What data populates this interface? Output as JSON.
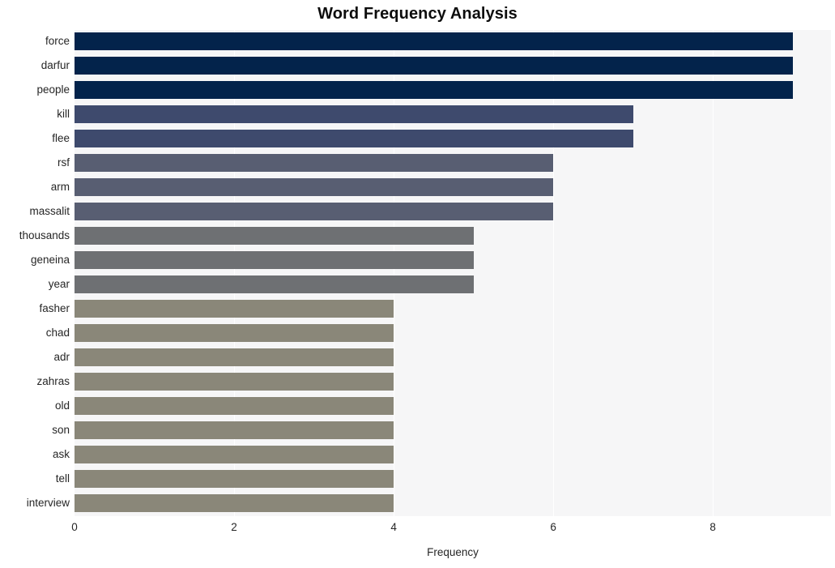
{
  "chart_data": {
    "type": "bar",
    "orientation": "horizontal",
    "title": "Word Frequency Analysis",
    "xlabel": "Frequency",
    "ylabel": "",
    "categories": [
      "force",
      "darfur",
      "people",
      "kill",
      "flee",
      "rsf",
      "arm",
      "massalit",
      "thousands",
      "geneina",
      "year",
      "fasher",
      "chad",
      "adr",
      "zahras",
      "old",
      "son",
      "ask",
      "tell",
      "interview"
    ],
    "values": [
      9,
      9,
      9,
      7,
      7,
      6,
      6,
      6,
      5,
      5,
      5,
      4,
      4,
      4,
      4,
      4,
      4,
      4,
      4,
      4
    ],
    "bar_colors": [
      "#03234b",
      "#03234b",
      "#03234b",
      "#3e4a6d",
      "#3e4a6d",
      "#585e72",
      "#585e72",
      "#585e72",
      "#6e7073",
      "#6e7073",
      "#6e7073",
      "#8a8779",
      "#8a8779",
      "#8a8779",
      "#8a8779",
      "#8a8779",
      "#8a8779",
      "#8a8779",
      "#8a8779",
      "#8a8779"
    ],
    "xlim": [
      0,
      9.48
    ],
    "xticks": [
      0,
      2,
      4,
      6,
      8
    ],
    "xtick_labels": [
      "0",
      "2",
      "4",
      "6",
      "8"
    ],
    "grid": true,
    "grid_axis": "x",
    "legend": "none",
    "plot_background": "#f6f6f7",
    "figure_background": "#ffffff",
    "gridline_color": "#ffffff",
    "tick_label_color": "#262626",
    "title_color": "#0d0d0d"
  }
}
